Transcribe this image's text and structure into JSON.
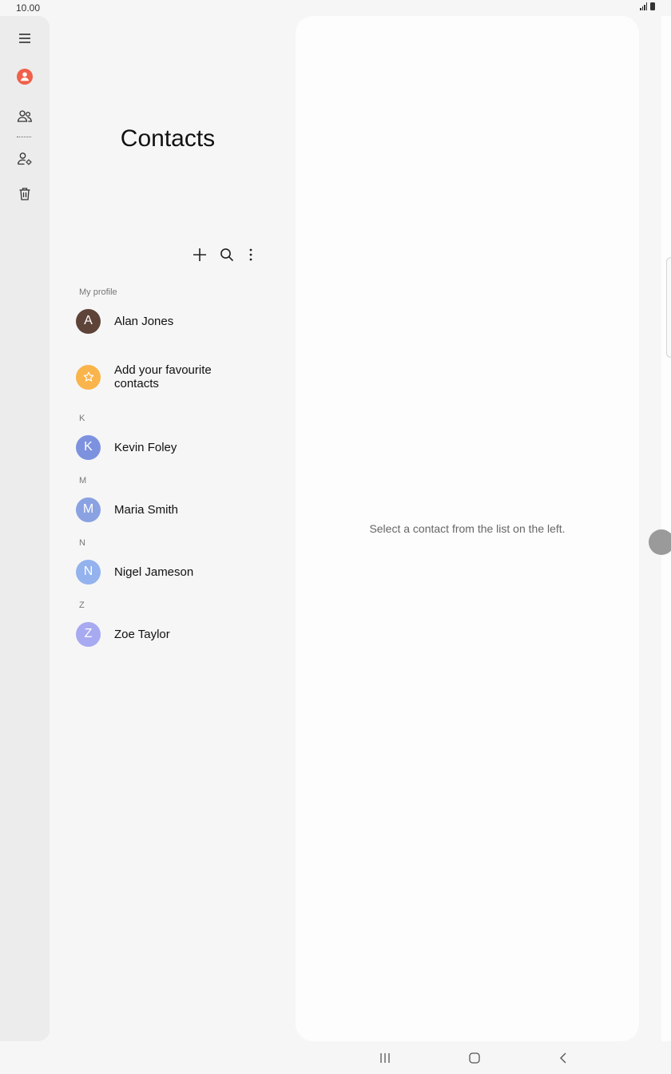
{
  "status_bar": {
    "time": "10.00",
    "signal_icon": "signal-icon",
    "battery_icon": "battery-icon"
  },
  "rail": {
    "items": [
      {
        "name": "menu-icon",
        "label": "Menu"
      },
      {
        "name": "profile-icon",
        "label": "Profile"
      },
      {
        "name": "groups-icon",
        "label": "Groups"
      },
      {
        "name": "manage-contacts-icon",
        "label": "Manage contacts"
      },
      {
        "name": "trash-icon",
        "label": "Trash"
      }
    ],
    "accent_color": "#f0604a"
  },
  "list": {
    "title": "Contacts",
    "toolbar": {
      "add_icon": "plus-icon",
      "search_icon": "search-icon",
      "more_icon": "more-vert-icon"
    },
    "my_profile_label": "My profile",
    "profile": {
      "initial": "A",
      "name": "Alan Jones",
      "color": "#5e4339"
    },
    "favourites": {
      "text_line1": "Add your favourite",
      "text_line2": "contacts",
      "icon": "star-icon",
      "color": "#f9b44b"
    },
    "sections": [
      {
        "letter": "K",
        "contact": {
          "initial": "K",
          "name": "Kevin Foley",
          "color": "#7d92df"
        }
      },
      {
        "letter": "M",
        "contact": {
          "initial": "M",
          "name": "Maria Smith",
          "color": "#8aa2e2"
        }
      },
      {
        "letter": "N",
        "contact": {
          "initial": "N",
          "name": "Nigel Jameson",
          "color": "#93b2ee"
        }
      },
      {
        "letter": "Z",
        "contact": {
          "initial": "Z",
          "name": "Zoe Taylor",
          "color": "#a7a9f1"
        }
      }
    ]
  },
  "detail": {
    "empty_message": "Select a contact from the list on the left."
  },
  "nav_bar": {
    "recents_icon": "recents-icon",
    "home_icon": "home-icon",
    "back_icon": "back-icon"
  }
}
